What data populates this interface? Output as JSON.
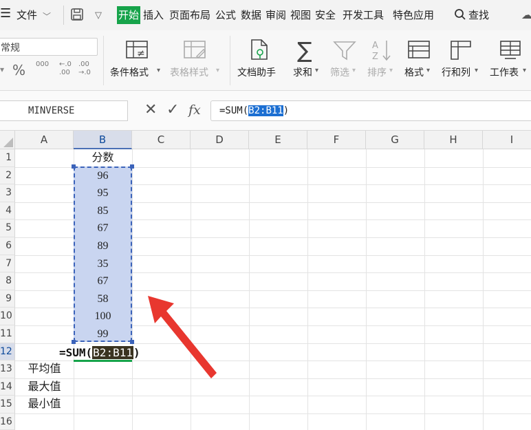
{
  "menu": {
    "items": [
      "文件",
      "开始",
      "插入",
      "页面布局",
      "公式",
      "数据",
      "审阅",
      "视图",
      "安全",
      "开发工具",
      "特色应用"
    ],
    "active": "开始",
    "search_label": "查找",
    "accent": "#16a34a"
  },
  "ribbon": {
    "number_format": "常规",
    "percent": "%",
    "thousands": "000",
    "inc_decimal": "←.0 .00",
    "dec_decimal": ".00 →.0",
    "buttons": [
      "条件格式",
      "表格样式",
      "文档助手",
      "求和",
      "筛选",
      "排序",
      "格式",
      "行和列",
      "工作表"
    ],
    "disabled_buttons": [
      "表格样式",
      "筛选",
      "排序"
    ]
  },
  "formula_bar": {
    "name_box": "MINVERSE",
    "fx_label": "fx",
    "formula_prefix": "=SUM(",
    "formula_ref": "B2:B11",
    "formula_suffix": ")"
  },
  "sheet": {
    "columns": [
      "A",
      "B",
      "C",
      "D",
      "E",
      "F",
      "G",
      "H",
      "I"
    ],
    "rows": [
      "1",
      "2",
      "3",
      "4",
      "5",
      "6",
      "7",
      "8",
      "9",
      "10",
      "11",
      "12",
      "13",
      "14",
      "15",
      "16"
    ],
    "header_b1": "分数",
    "scores": [
      "96",
      "95",
      "85",
      "67",
      "89",
      "35",
      "67",
      "58",
      "100",
      "99"
    ],
    "row12_formula_prefix": "=SUM(",
    "row12_formula_ref": "B2:B11",
    "row12_formula_suffix": ")",
    "labels": [
      "平均值",
      "最大值",
      "最小值"
    ],
    "selected_range": "B2:B11",
    "arrow_color": "#e8372f"
  }
}
